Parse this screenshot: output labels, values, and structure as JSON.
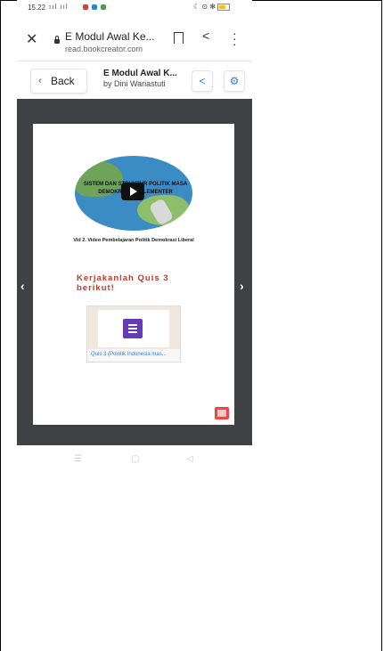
{
  "status_bar": {
    "time": "15.22",
    "signal": "ııl ııl",
    "right": "☾ ⊙ ✻"
  },
  "browser": {
    "page_title": "E Modul Awal Ke...",
    "host": "read.bookcreator.com"
  },
  "book_toolbar": {
    "back_label": "Back",
    "title": "E Modul Awal K...",
    "author": "by Dini Wariastuti"
  },
  "page": {
    "video_text": "SISTEM DAN STRUKTUR POLITIK MASA DEMOKRASI PARLEMENTER",
    "video_caption": "Vid 2. Video Pembelajaran Politik Demokrasi Liberal",
    "quiz_heading": "Kerjakanlah Quis 3 berikut!",
    "quiz_link": "Quis 3 (Polotik Indonesia mas..."
  },
  "colors": {
    "accent": "#2c7be5",
    "viewer_bg": "#3f4145",
    "quiz_heading": "#c0392b",
    "forms_purple": "#673ab7"
  },
  "icons": {
    "close": "close-icon",
    "lock": "lock-icon",
    "bookmark": "bookmark-icon",
    "share": "share-icon",
    "more": "more-vert-icon",
    "settings": "gear-icon",
    "prev": "chevron-left-icon",
    "next": "chevron-right-icon"
  }
}
